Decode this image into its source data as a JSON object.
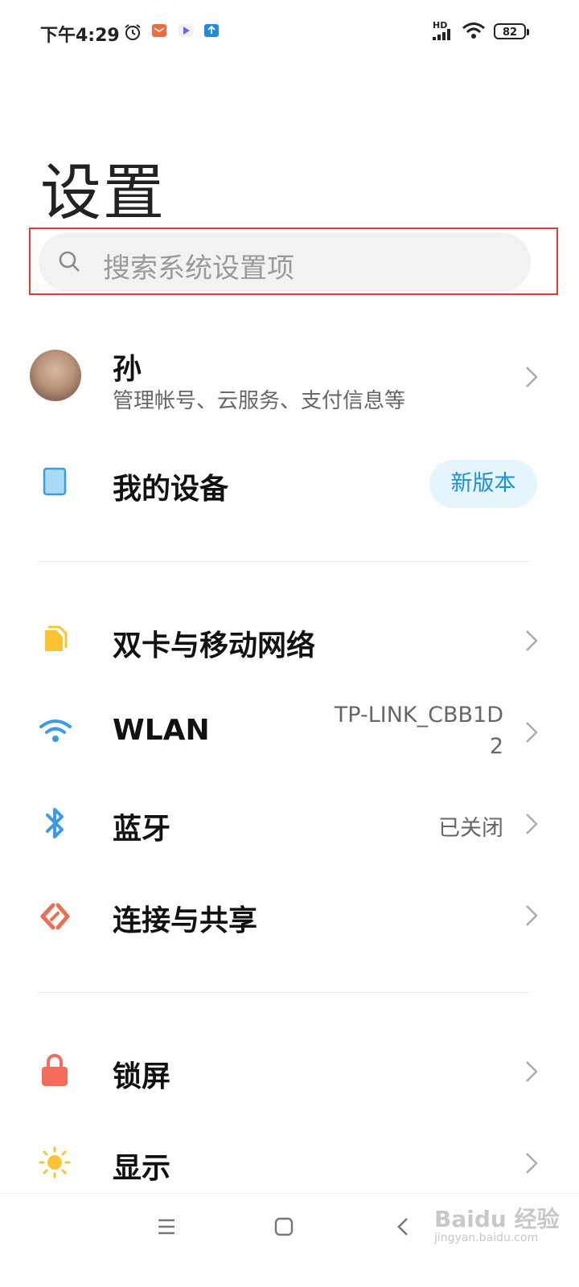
{
  "status_bar": {
    "time": "下午4:29",
    "battery": "82",
    "network_label": "HD"
  },
  "header": {
    "title": "设置"
  },
  "search": {
    "placeholder": "搜索系统设置项"
  },
  "account": {
    "name": "孙",
    "subtitle": "管理帐号、云服务、支付信息等"
  },
  "device": {
    "label": "我的设备",
    "badge": "新版本"
  },
  "connectivity": {
    "dual_sim": "双卡与移动网络",
    "wlan": "WLAN",
    "wlan_value_line1": "TP-LINK_CBB1D",
    "wlan_value_line2": "2",
    "bluetooth": "蓝牙",
    "bluetooth_value": "已关闭",
    "sharing": "连接与共享"
  },
  "personal": {
    "lock_screen": "锁屏",
    "display": "显示"
  },
  "watermark": {
    "text": "Baidu 经验",
    "sub": "jingyan.baidu.com"
  },
  "colors": {
    "accent_blue": "#1a8fe0",
    "sim_yellow": "#fcc434",
    "wifi_blue": "#3a9ae8",
    "share_red": "#ee6d55",
    "lock_red": "#f36c5c",
    "sun_yellow": "#fcc434",
    "highlight_red": "#e53935"
  }
}
